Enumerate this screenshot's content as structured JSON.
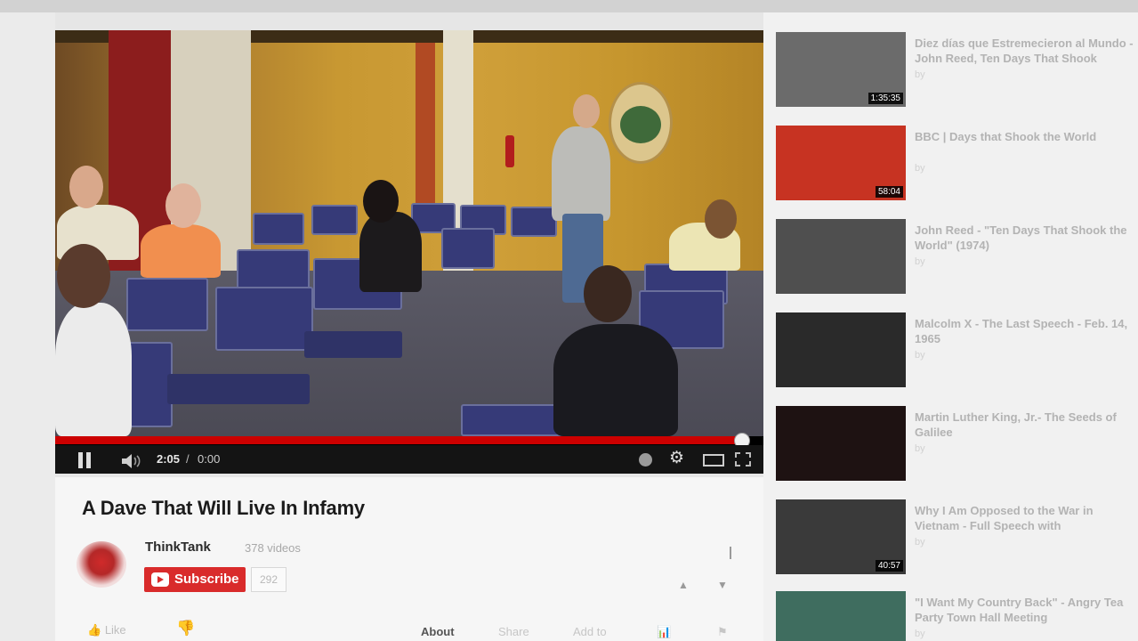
{
  "player": {
    "time_current": "2:05",
    "time_separator": "/",
    "time_total": "0:00",
    "progress": 0.97
  },
  "video": {
    "title": "A Dave That Will Live In Infamy"
  },
  "channel": {
    "name": "ThinkTank",
    "video_count": "378 videos",
    "subscribe_label": "Subscribe",
    "subscriber_count": "292"
  },
  "actions": {
    "like_label": "Like",
    "tabs": [
      "About",
      "Share",
      "Add to",
      "",
      ""
    ]
  },
  "sidebar": {
    "items": [
      {
        "title": "Diez días que Estremecieron al Mundo - John Reed, Ten Days That Shook",
        "channel": "by",
        "views": "",
        "duration": "1:35:35",
        "thumb": "#6b6b6b"
      },
      {
        "title": "BBC | Days that Shook the World",
        "channel": "by",
        "views": "",
        "duration": "58:04",
        "thumb": "#c73322"
      },
      {
        "title": "John Reed - \"Ten Days That Shook the World\" (1974)",
        "channel": "by",
        "views": "",
        "duration": "",
        "thumb": "#4f4f4f"
      },
      {
        "title": "Malcolm X - The Last Speech - Feb. 14, 1965",
        "channel": "by",
        "views": "",
        "duration": "",
        "thumb": "#2a2a2a"
      },
      {
        "title": "Martin Luther King, Jr.- The Seeds of Galilee",
        "channel": "by",
        "views": "",
        "duration": "",
        "thumb": "#1e1212"
      },
      {
        "title": "Why I Am Opposed to the War in Vietnam - Full Speech with",
        "channel": "by",
        "views": "",
        "duration": "40:57",
        "thumb": "#3a3a3a"
      },
      {
        "title": "\"I Want My Country Back\" - Angry Tea Party Town Hall Meeting",
        "channel": "by",
        "views": "",
        "duration": "",
        "thumb": "#3f6d5f"
      }
    ]
  }
}
